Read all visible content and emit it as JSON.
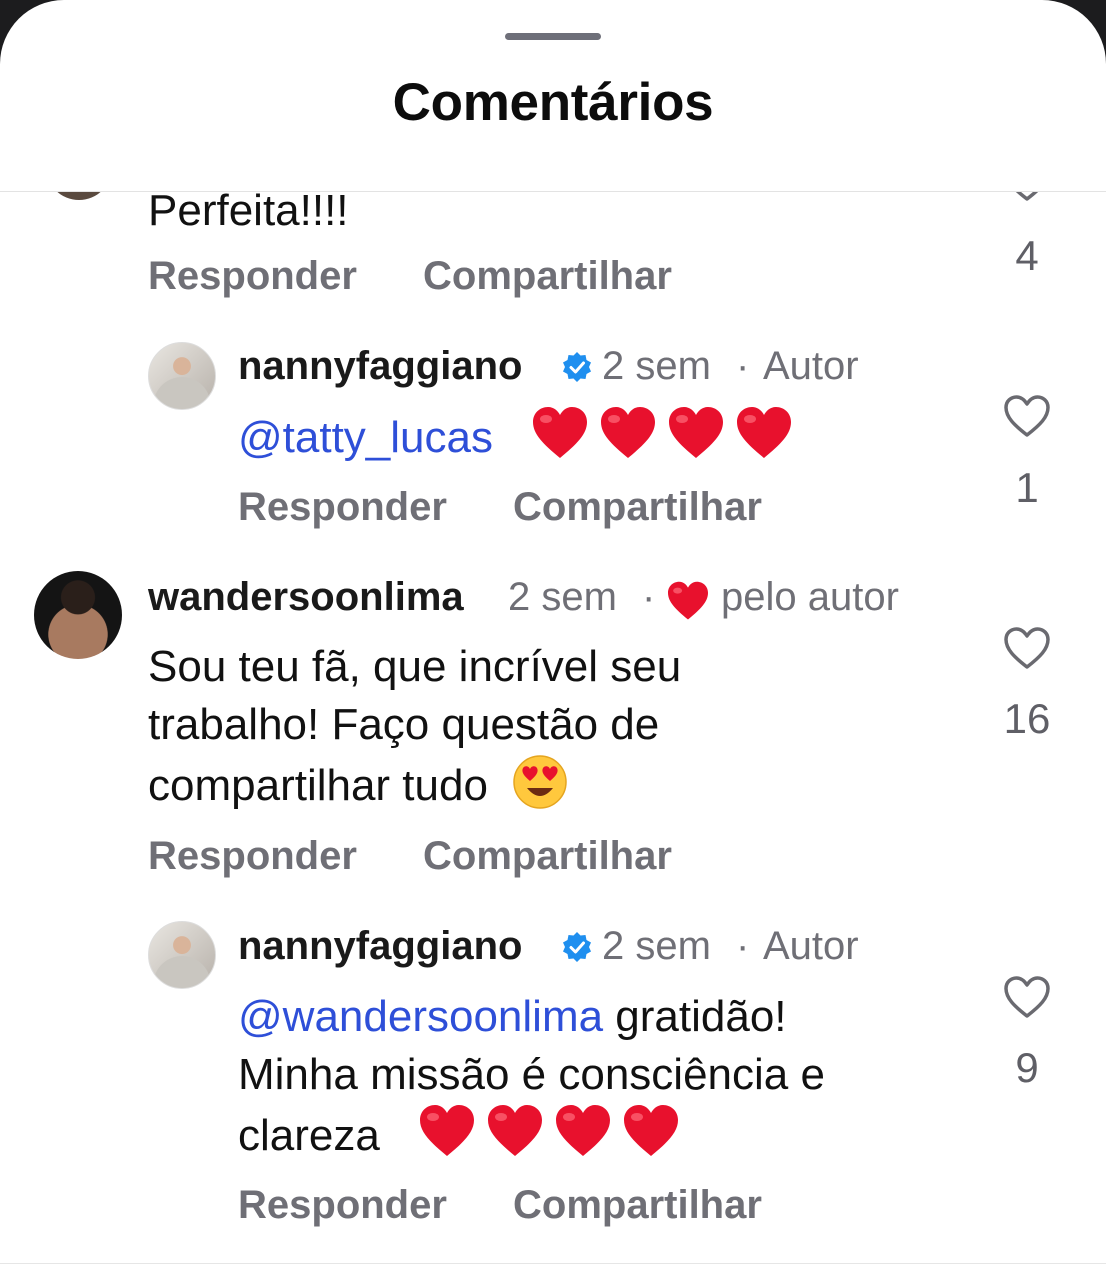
{
  "header": {
    "title": "Comentários"
  },
  "actions": {
    "reply": "Responder",
    "share": "Compartilhar"
  },
  "colors": {
    "mention": "#2e4fd8",
    "meta": "#6f6f76",
    "verified": "#1f8fef",
    "heart": "#e8112d"
  },
  "comments": [
    {
      "id": "partial-top",
      "text": "Perfeita!!!!",
      "likes": "4"
    },
    {
      "id": "reply-1",
      "username": "nannyfaggiano",
      "verified": true,
      "time": "2 sem",
      "separator": "·",
      "badge": "Autor",
      "mention": "@tatty_lucas",
      "emoji": "heart-emoji x4",
      "likes": "1"
    },
    {
      "id": "comment-2",
      "username": "wandersoonlima",
      "time": "2 sem",
      "separator": "·",
      "liked_by_author_label": "pelo autor",
      "lines": [
        "Sou teu fã, que incrível seu",
        "trabalho! Faço questão de",
        "compartilhar tudo"
      ],
      "emoji": "heart-eyes-emoji",
      "likes": "16"
    },
    {
      "id": "reply-2",
      "username": "nannyfaggiano",
      "verified": true,
      "time": "2 sem",
      "separator": "·",
      "badge": "Autor",
      "mention": "@wandersoonlima",
      "line1_rest": " gratidão!",
      "line2": "Minha missão é consciência e",
      "line3": "clareza",
      "emoji": "heart-emoji x4",
      "likes": "9"
    }
  ]
}
